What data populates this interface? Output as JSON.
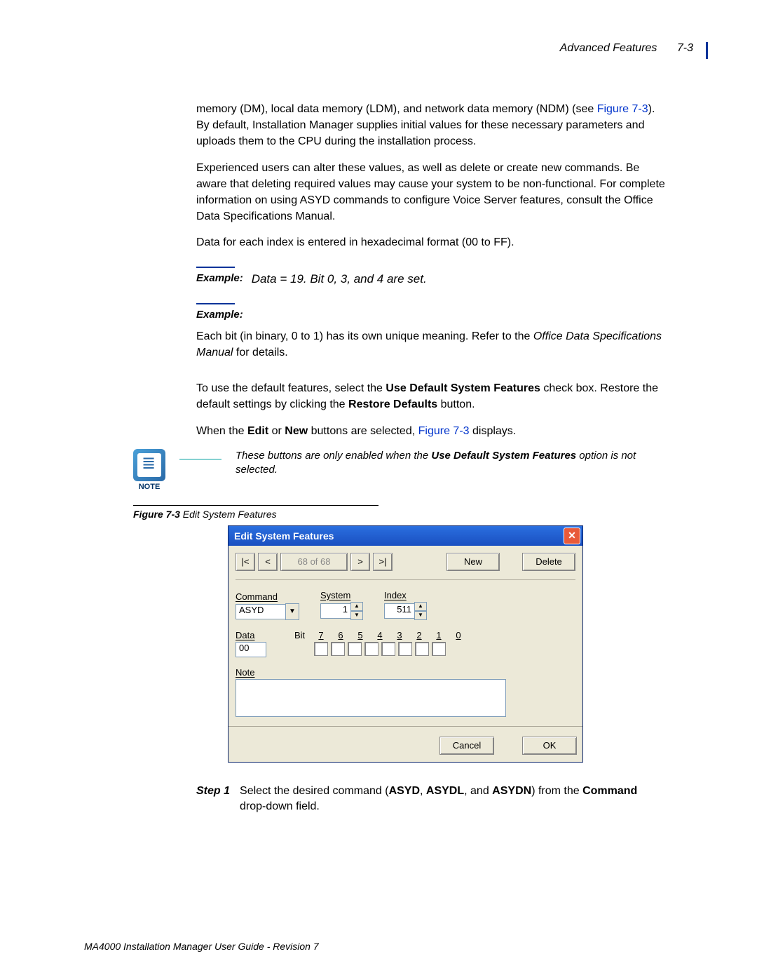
{
  "header": {
    "section": "Advanced Features",
    "page": "7-3"
  },
  "body": {
    "p1a": "memory (DM), local data memory (LDM), and network data memory (NDM) (see ",
    "p1link": "Figure 7-3",
    "p1b": "). By default, Installation Manager supplies initial values for these necessary parameters and uploads them to the CPU during the installation process.",
    "p2": "Experienced users can alter these values, as well as delete or create new commands. Be aware that deleting required values may cause your system to be non-functional. For complete information on using ASYD commands to configure Voice Server features, consult the Office Data Specifications Manual.",
    "p3": "Data for each index is entered in hexadecimal format (00 to FF).",
    "example1_label": "Example:",
    "example1_text": "Data = 19. Bit 0, 3, and 4 are set.",
    "example2_label": "Example:",
    "p4a": "Each bit (in binary, 0 to 1) has its own unique meaning. Refer to the ",
    "p4i": "Office Data Specifications Manual",
    "p4b": " for details.",
    "p5a": "To use the default features, select the ",
    "p5b1": "Use Default System Features",
    "p5c": " check box. Restore the default settings by clicking the ",
    "p5b2": "Restore Defaults",
    "p5d": " button.",
    "p6a": "When the ",
    "p6b1": "Edit",
    "p6b": " or ",
    "p6b2": "New",
    "p6c": " buttons are selected, ",
    "p6link": "Figure 7-3",
    "p6d": " displays."
  },
  "note": {
    "caption": "NOTE",
    "text_a": "These buttons are only enabled when the ",
    "text_b": "Use Default System Features",
    "text_c": " option is not selected."
  },
  "figure": {
    "label": "Figure 7-3",
    "title": "Edit System Features"
  },
  "dialog": {
    "title": "Edit System Features",
    "nav": {
      "first": "|<",
      "prev": "<",
      "counter": "68 of 68",
      "next": ">",
      "last": ">|",
      "new": "New",
      "delete": "Delete"
    },
    "command": {
      "label": "Command",
      "value": "ASYD"
    },
    "system": {
      "label": "System",
      "value": "1"
    },
    "index": {
      "label": "Index",
      "value": "511"
    },
    "data": {
      "label": "Data",
      "value": "00"
    },
    "bits": {
      "label": "Bit",
      "headers": [
        "7",
        "6",
        "5",
        "4",
        "3",
        "2",
        "1",
        "0"
      ]
    },
    "noteField": {
      "label": "Note",
      "value": ""
    },
    "footer": {
      "cancel": "Cancel",
      "ok": "OK"
    }
  },
  "step": {
    "label": "Step 1",
    "a": "Select the desired command (",
    "b1": "ASYD",
    "s1": ", ",
    "b2": "ASYDL",
    "s2": ", and ",
    "b3": "ASYDN",
    "c": ") from the ",
    "b4": "Command",
    "d": " drop-down field."
  },
  "footer": "MA4000 Installation Manager User Guide - Revision 7"
}
